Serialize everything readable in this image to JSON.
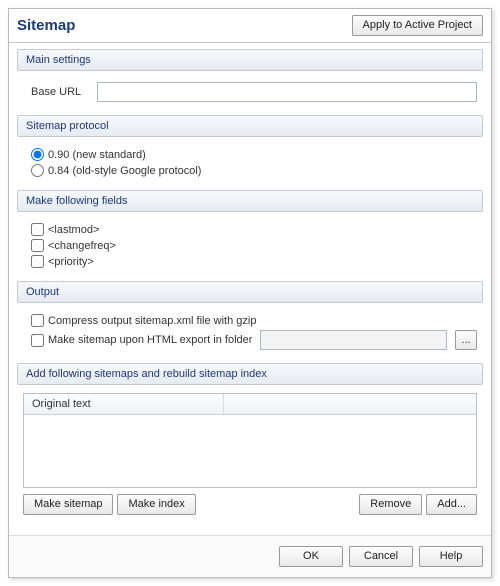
{
  "title": "Sitemap",
  "apply_button": "Apply to Active Project",
  "main_settings": {
    "header": "Main settings",
    "base_url_label": "Base URL",
    "base_url_value": ""
  },
  "protocol": {
    "header": "Sitemap protocol",
    "options": [
      {
        "label": "0.90 (new standard)",
        "checked": true
      },
      {
        "label": "0.84 (old-style Google protocol)",
        "checked": false
      }
    ]
  },
  "fields": {
    "header": "Make following fields",
    "items": [
      {
        "label": "<lastmod>",
        "checked": false
      },
      {
        "label": "<changefreq>",
        "checked": false
      },
      {
        "label": "<priority>",
        "checked": false
      }
    ]
  },
  "output": {
    "header": "Output",
    "compress_label": "Compress output sitemap.xml file with gzip",
    "compress_checked": false,
    "export_label": "Make sitemap upon HTML export in folder",
    "export_checked": false,
    "export_folder": "",
    "browse_label": "..."
  },
  "rebuild": {
    "header": "Add following sitemaps and rebuild sitemap index",
    "column": "Original text",
    "make_sitemap": "Make sitemap",
    "make_index": "Make index",
    "remove": "Remove",
    "add": "Add..."
  },
  "footer": {
    "ok": "OK",
    "cancel": "Cancel",
    "help": "Help"
  }
}
